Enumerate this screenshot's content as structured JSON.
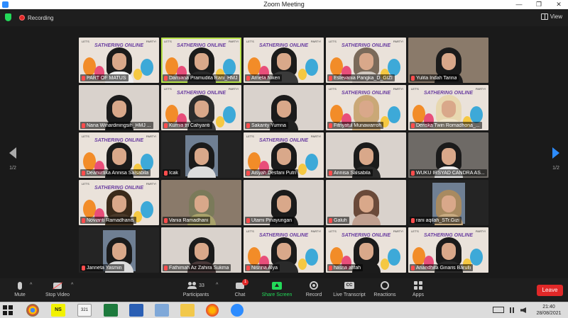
{
  "window": {
    "title": "Zoom Meeting",
    "minimize_glyph": "—",
    "restore_glyph": "❐",
    "close_glyph": "✕"
  },
  "meeting_bar": {
    "recording_label": "Recording",
    "view_label": "View"
  },
  "pagination": {
    "left_page": "1/2",
    "right_page": "1/2"
  },
  "tiles": [
    {
      "name": "PART OF MATUS",
      "bg": "poster",
      "hair": "#1b1b1b",
      "body": "#f1f1f1",
      "active": false
    },
    {
      "name": "Damiana Pramudita Rani_HMJ",
      "bg": "poster",
      "hair": "#1b1b1b",
      "body": "#2b2b2b",
      "active": true
    },
    {
      "name": "Arneta Niken",
      "bg": "poster",
      "hair": "#1b1b1b",
      "body": "#3a3a3a",
      "active": false
    },
    {
      "name": "Estevania Pangka_D_GIZI",
      "bg": "poster",
      "hair": "#7a6a5a",
      "body": "#d0c8c0",
      "active": false
    },
    {
      "name": "Yulita Indah Tarina",
      "bg": "room",
      "hair": "#1b1b1b",
      "body": "#1a1a1a",
      "active": false
    },
    {
      "name": "Nana Winardiningsih_HMJ ...",
      "bg": "light",
      "hair": "#1b1b1b",
      "body": "#1d1d1d",
      "active": false
    },
    {
      "name": "Kurnia tri Cahyanti",
      "bg": "poster",
      "hair": "#2c2c2c",
      "body": "#3d3d3d",
      "active": false
    },
    {
      "name": "Sakanty Yumna",
      "bg": "light",
      "hair": "#1b1b1b",
      "body": "#222222",
      "active": false
    },
    {
      "name": "Fitriyatul Munawarroh",
      "bg": "poster",
      "hair": "#caa877",
      "body": "#caa877",
      "active": false
    },
    {
      "name": "Deriska Twin Romadhona_...",
      "bg": "poster",
      "hair": "#e8d8b0",
      "body": "#f0e4c8",
      "active": false
    },
    {
      "name": "Deanurtika Annisa Salsabila",
      "bg": "poster",
      "hair": "#1b1b1b",
      "body": "#1b1b1b",
      "active": false
    },
    {
      "name": "Icak",
      "bg": "dark",
      "hair": "#1b1b1b",
      "body": "#dcdcdc",
      "active": false
    },
    {
      "name": "Aisyah Desfani Putri",
      "bg": "poster",
      "hair": "#1b1b1b",
      "body": "#1b1b1b",
      "active": false
    },
    {
      "name": "Annisa Salsabila",
      "bg": "light",
      "hair": "#1b1b1b",
      "body": "#2a2a2a",
      "active": false
    },
    {
      "name": "WUKU IRSYAD CANDRA AS...",
      "bg": "room2",
      "hair": "#1b1b1b",
      "body": "#ececec",
      "active": false
    },
    {
      "name": "Novianti Ramadhanis",
      "bg": "poster",
      "hair": "#3a2a1a",
      "body": "#4a3a2a",
      "active": false
    },
    {
      "name": "Vania Ramadhani",
      "bg": "room",
      "hair": "#7a7a5a",
      "body": "#a8a26a",
      "active": false
    },
    {
      "name": "Utami Pinayungan",
      "bg": "light",
      "hair": "#1b1b1b",
      "body": "#1d1d1d",
      "active": false
    },
    {
      "name": "Galuh",
      "bg": "light",
      "hair": "#6a4a3a",
      "body": "#c0a090",
      "active": false
    },
    {
      "name": "rani aqilah_STr.Gizi",
      "bg": "dark",
      "hair": "#a88a60",
      "body": "#c8aa80",
      "active": false
    },
    {
      "name": "Janneta Yasmin",
      "bg": "dark",
      "hair": "#1b1b1b",
      "body": "#dcdcdc",
      "active": false
    },
    {
      "name": "Fathimah Az Zahira Sukma",
      "bg": "light",
      "hair": "#1b1b1b",
      "body": "#4a3a3a",
      "active": false
    },
    {
      "name": "Nisrina Alya",
      "bg": "poster",
      "hair": "#1b1b1b",
      "body": "#2a2a2a",
      "active": false
    },
    {
      "name": "hasna afifah",
      "bg": "poster",
      "hair": "#1b1b1b",
      "body": "#1b1b1b",
      "active": false
    },
    {
      "name": "Anandhita Ginaris Barulli",
      "bg": "poster",
      "hair": "#1b1b1b",
      "body": "#2a2a2a",
      "active": false
    }
  ],
  "poster": {
    "lets": "LET'S",
    "party": "PARTY!",
    "title": "SATHERING ONLINE"
  },
  "toolbar": {
    "mute": "Mute",
    "stop_video": "Stop Video",
    "participants": "Participants",
    "participants_count": "33",
    "chat": "Chat",
    "chat_badge": "1",
    "share_screen": "Share Screen",
    "record": "Record",
    "live_transcript": "Live Transcript",
    "cc": "CC",
    "reactions": "Reactions",
    "apps": "Apps",
    "leave": "Leave",
    "caret": "^"
  },
  "taskbar": {
    "clock_time": "21:40",
    "clock_date": "28/08/2021",
    "ns_label": "NS",
    "calendar_label": "321"
  },
  "colors": {
    "accent_green": "#23d959",
    "leave_red": "#e02828",
    "zoom_blue": "#2d8cff",
    "active_outline": "#b8e34a"
  }
}
